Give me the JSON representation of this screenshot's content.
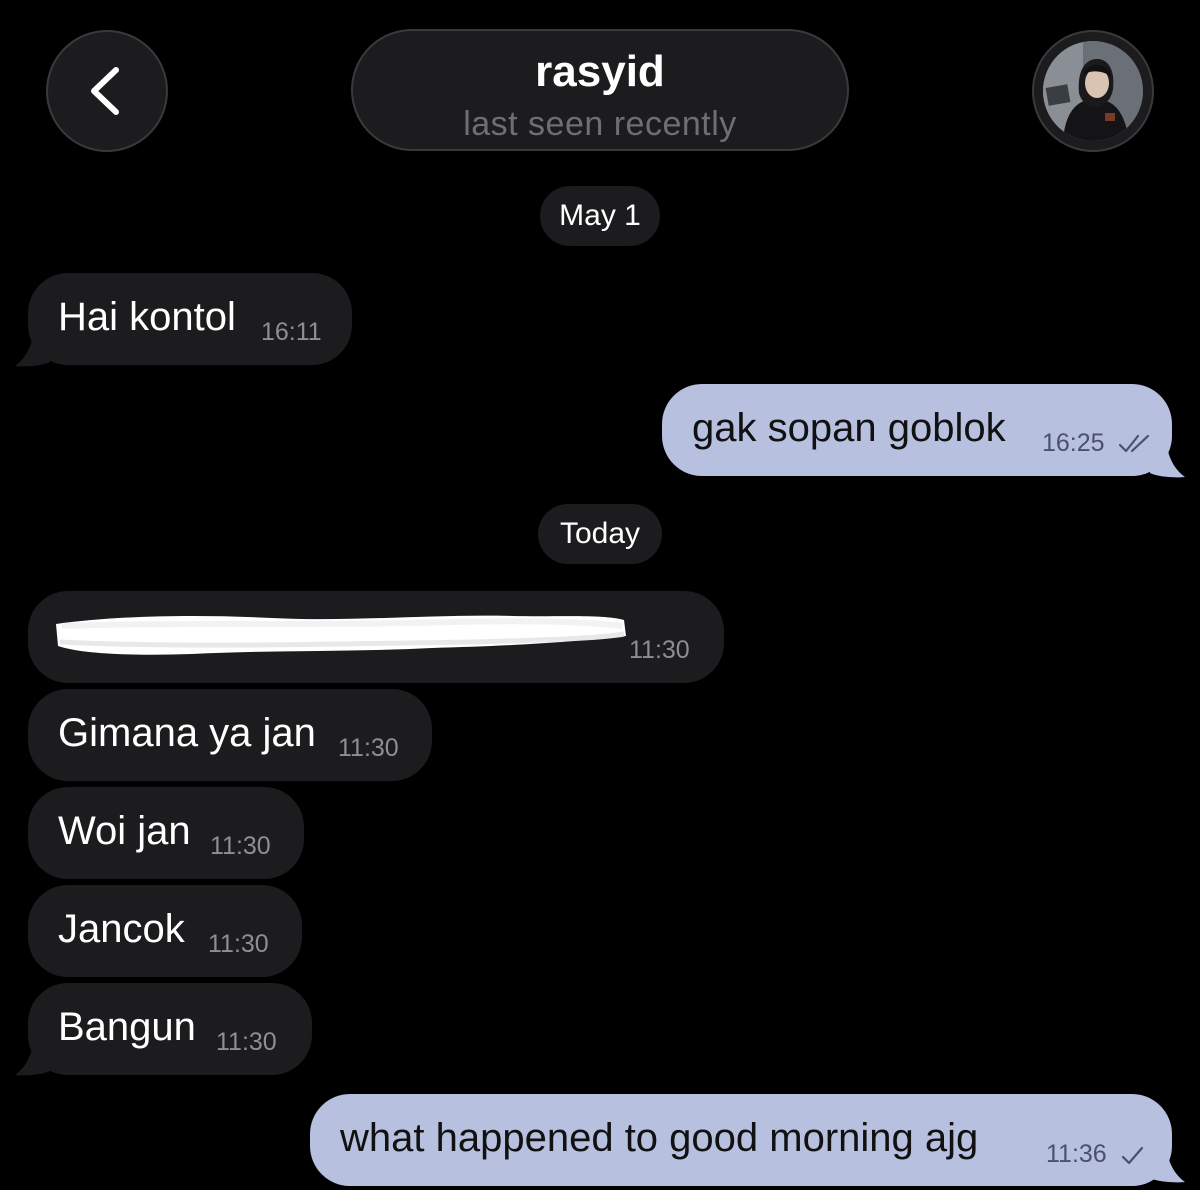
{
  "header": {
    "back_icon": "chevron-left-icon",
    "contact_name": "rasyid",
    "status": "last seen recently",
    "avatar_icon": "contact-avatar"
  },
  "date_dividers": [
    "May 1",
    "Today"
  ],
  "messages": [
    {
      "direction": "incoming",
      "text": "Hai kontol",
      "time": "16:11"
    },
    {
      "direction": "outgoing",
      "text": "gak sopan goblok",
      "time": "16:25",
      "status": "read"
    },
    {
      "direction": "incoming",
      "text": "",
      "redacted": true,
      "time": "11:30"
    },
    {
      "direction": "incoming",
      "text": "Gimana ya jan",
      "time": "11:30"
    },
    {
      "direction": "incoming",
      "text": "Woi jan",
      "time": "11:30"
    },
    {
      "direction": "incoming",
      "text": "Jancok",
      "time": "11:30"
    },
    {
      "direction": "incoming",
      "text": "Bangun",
      "time": "11:30"
    },
    {
      "direction": "outgoing",
      "text": "what happened to good morning ajg",
      "time": "11:36",
      "status": "delivered"
    }
  ],
  "colors": {
    "background": "#000000",
    "incoming_bubble": "#1c1c1e",
    "outgoing_bubble": "#b8c0e0",
    "timestamp_gray": "#8e8e93"
  }
}
